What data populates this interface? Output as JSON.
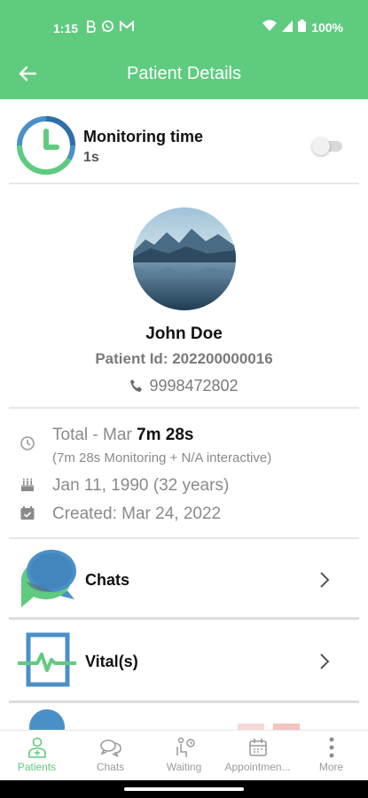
{
  "status_bar": {
    "time": "1:15",
    "battery": "100%",
    "icons": [
      "b-icon",
      "whatsapp-icon",
      "gmail-icon",
      "wifi-icon",
      "signal-icon",
      "battery-icon"
    ]
  },
  "app_bar": {
    "title": "Patient Details",
    "background": "#5fcb7f"
  },
  "monitoring": {
    "label": "Monitoring time",
    "value": "1s",
    "toggle_on": false
  },
  "patient": {
    "name": "John Doe",
    "id_text": "Patient Id: 202200000016",
    "phone": "9998472802"
  },
  "info": {
    "total_prefix": "Total - Mar ",
    "total_value": "7m 28s",
    "total_detail": "(7m 28s Monitoring + N/A interactive)",
    "dob": "Jan 11, 1990 (32 years)",
    "created": "Created: Mar 24, 2022"
  },
  "menu": [
    {
      "label": "Chats"
    },
    {
      "label": "Vital(s)"
    }
  ],
  "bottom_nav": [
    {
      "label": "Patients",
      "active": true
    },
    {
      "label": "Chats",
      "active": false
    },
    {
      "label": "Waiting",
      "active": false
    },
    {
      "label": "Appointmen...",
      "active": false
    },
    {
      "label": "More",
      "active": false
    }
  ],
  "colors": {
    "accent": "#5fcb7f",
    "chat_blue": "#4a90c8",
    "chat_green": "#5fcb7f"
  }
}
